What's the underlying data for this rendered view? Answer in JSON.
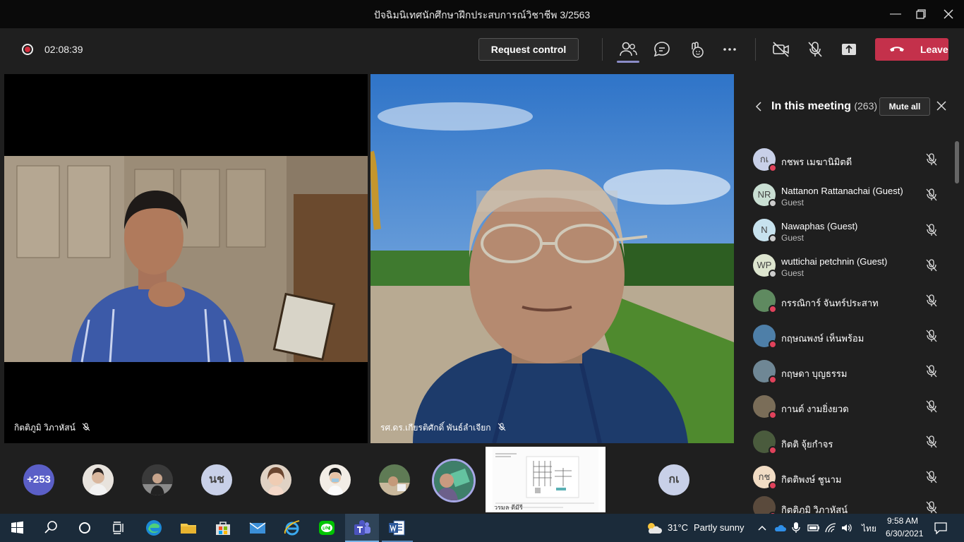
{
  "window": {
    "title": "ปัจฉิมนิเทศนักศึกษาฝึกประสบการณ์วิชาชีพ 3/2563"
  },
  "toolbar": {
    "timer": "02:08:39",
    "request_control": "Request control",
    "leave": "Leave"
  },
  "videos": [
    {
      "name": "กิตติภูมิ วิภาหัสน์"
    },
    {
      "name": "รศ.ดร.เกียรติศักดิ์ พันธ์ลำเจียก"
    }
  ],
  "strip": {
    "count": "+253",
    "initials_1": "นช",
    "initials_2": "กเ",
    "share_label": "วรมล ดีมีรี"
  },
  "panel": {
    "title": "In this meeting",
    "count": "(263)",
    "mute_all": "Mute all",
    "participants": [
      {
        "initials": "กเ",
        "name": "กชพร เมฆานิมิตดี",
        "sub": "",
        "status": "#e0425b",
        "avatar_bg": "#c8d0e8"
      },
      {
        "initials": "NR",
        "name": "Nattanon Rattanachai (Guest)",
        "sub": "Guest",
        "status": "#cccccc",
        "avatar_bg": "#c9dfd3"
      },
      {
        "initials": "N",
        "name": "Nawaphas (Guest)",
        "sub": "Guest",
        "status": "#cccccc",
        "avatar_bg": "#c7e2ee"
      },
      {
        "initials": "WP",
        "name": "wuttichai petchnin (Guest)",
        "sub": "Guest",
        "status": "#cccccc",
        "avatar_bg": "#dde5cf"
      },
      {
        "initials": "",
        "name": "กรรณิการ์ จันทร์ประสาท",
        "sub": "",
        "status": "#e0425b",
        "avatar_bg": "#5f8a60"
      },
      {
        "initials": "",
        "name": "กฤษณพงษ์ เห็นพร้อม",
        "sub": "",
        "status": "#e0425b",
        "avatar_bg": "#4e7fa8"
      },
      {
        "initials": "",
        "name": "กฤษดา บุญธรรม",
        "sub": "",
        "status": "#e0425b",
        "avatar_bg": "#6f8795"
      },
      {
        "initials": "",
        "name": "กานต์ งามยิ่งยวด",
        "sub": "",
        "status": "#e0425b",
        "avatar_bg": "#7a6d58"
      },
      {
        "initials": "",
        "name": "กิตติ จุ้ยกำจร",
        "sub": "",
        "status": "#e0425b",
        "avatar_bg": "#4a5b3d"
      },
      {
        "initials": "กช",
        "name": "กิตติพงษ์ ชูนาม",
        "sub": "",
        "status": "#e0425b",
        "avatar_bg": "#f1dcc4"
      },
      {
        "initials": "",
        "name": "กิตติภูมิ วิภาหัสน์",
        "sub": "",
        "status": "#e0425b",
        "avatar_bg": "#5a4a3c"
      }
    ]
  },
  "taskbar": {
    "weather_temp": "31°C",
    "weather_text": "Partly sunny",
    "language": "ไทย",
    "time": "9:58 AM",
    "date": "6/30/2021"
  }
}
